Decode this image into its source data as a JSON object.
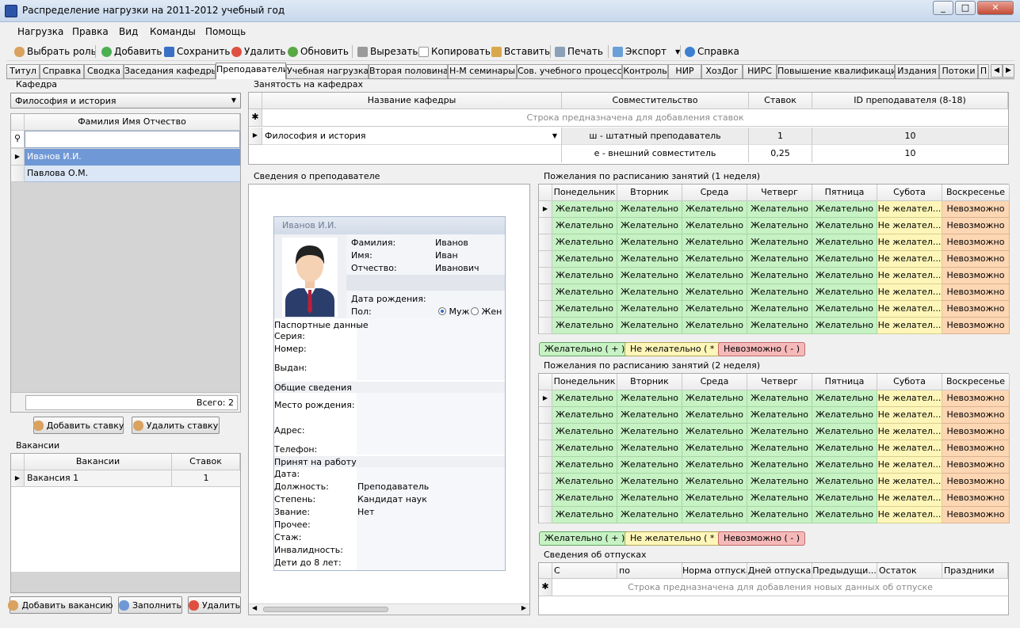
{
  "window": {
    "title": "Распределение нагрузки на 2011-2012 учебный год"
  },
  "menu": [
    "Нагрузка",
    "Правка",
    "Вид",
    "Команды",
    "Помощь"
  ],
  "toolbar": {
    "select_role": "Выбрать роль",
    "add": "Добавить",
    "save": "Сохранить",
    "delete": "Удалить",
    "refresh": "Обновить",
    "cut": "Вырезать",
    "copy": "Копировать",
    "paste": "Вставить",
    "print": "Печать",
    "export": "Экспорт",
    "help": "Справка"
  },
  "tabs": [
    "Титул",
    "Справка",
    "Сводка",
    "Заседания кафедры",
    "Преподаватели",
    "Учебная нагрузка",
    "Вторая половина",
    "Н-М семинары",
    "Сов. учебного процесса",
    "Контроль",
    "НИР",
    "ХозДог",
    "НИРС",
    "Повышение квалификации",
    "Издания",
    "Потоки",
    "П"
  ],
  "department": {
    "label": "Кафедра",
    "selected": "Философия и история",
    "column": "Фамилия Имя Отчество",
    "teachers": [
      "Иванов И.И.",
      "Павлова О.М."
    ],
    "total": "Всего: 2",
    "add_rate": "Добавить ставку",
    "delete_rate": "Удалить ставку"
  },
  "vacancies": {
    "label": "Вакансии",
    "columns": [
      "Вакансии",
      "Ставок"
    ],
    "rows": [
      [
        "Вакансия 1",
        "1"
      ]
    ],
    "add": "Добавить вакансию",
    "fill": "Заполнить",
    "delete": "Удалить"
  },
  "employment": {
    "label": "Занятость на кафедрах",
    "columns": [
      "Название кафедры",
      "Совместительство",
      "Ставок",
      "ID преподавателя (8-18)"
    ],
    "new_row_hint": "Строка предназначена для добавления ставок",
    "rows": [
      {
        "dept": "Философия и история",
        "type": "ш - штатный преподаватель",
        "rate": "1",
        "id": "10"
      },
      {
        "dept": "",
        "type": "е - внешний совместитель",
        "rate": "0,25",
        "id": "10"
      }
    ]
  },
  "teacher_info": {
    "label": "Сведения о преподавателе",
    "card_title": "Иванов И.И.",
    "fields": {
      "surname_label": "Фамилия:",
      "surname": "Иванов",
      "name_label": "Имя:",
      "name": "Иван",
      "patronymic_label": "Отчество:",
      "patronymic": "Иванович",
      "birth_label": "Дата рождения:",
      "sex_label": "Пол:",
      "male": "Муж",
      "female": "Жен",
      "passport_header": "Паспортные данные",
      "series_label": "Серия:",
      "number_label": "Номер:",
      "issued_label": "Выдан:",
      "general_header": "Общие сведения",
      "birthplace_label": "Место рождения:",
      "address_label": "Адрес:",
      "phone_label": "Телефон:",
      "hired_header": "Принят на работу",
      "date_label": "Дата:",
      "position_label": "Должность:",
      "position": "Преподаватель",
      "degree_label": "Степень:",
      "degree": "Кандидат наук",
      "title_label": "Звание:",
      "title": "Нет",
      "other_label": "Прочее:",
      "experience_label": "Стаж:",
      "disability_label": "Инвалидность:",
      "children_label": "Дети до 8 лет:"
    }
  },
  "schedule": {
    "week1_label": "Пожелания по расписанию занятий (1 неделя)",
    "week2_label": "Пожелания по расписанию занятий (2 неделя)",
    "days": [
      "Понедельник",
      "Вторник",
      "Среда",
      "Четверг",
      "Пятница",
      "Субота",
      "Воскресенье"
    ],
    "row_values": [
      "Желательно",
      "Желательно",
      "Желательно",
      "Желательно",
      "Желательно",
      "Не желател...",
      "Невозможно"
    ],
    "row_count": 8,
    "legend": {
      "desirable": "Желательно ( + )",
      "undesirable": "Не желательно ( * )",
      "impossible": "Невозможно ( - )"
    },
    "colors": {
      "desirable": "#c6f2c4",
      "undesirable": "#fdf6b8",
      "impossible": "#fdd6b4"
    }
  },
  "vacations": {
    "label": "Сведения об отпусках",
    "columns": [
      "С",
      "по",
      "Норма отпуска",
      "Дней отпуска",
      "Предыдущи...",
      "Остаток",
      "Праздники"
    ],
    "new_row_hint": "Строка предназначена для добавления новых данных об отпуске"
  }
}
